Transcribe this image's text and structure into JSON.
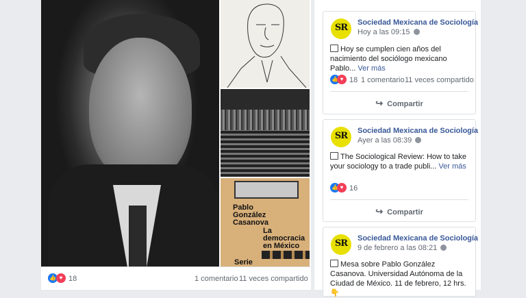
{
  "main": {
    "reactions": {
      "count": "18",
      "comments": "1 comentario",
      "shares": "11 veces compartido"
    },
    "book": {
      "author1": "Pablo",
      "author2": "González",
      "author3": "Casanova",
      "title1": "La",
      "title2": "democracia",
      "title3": "en México",
      "series": "Serie"
    }
  },
  "feed": {
    "posts": [
      {
        "page": "Sociedad Mexicana de Sociología",
        "time": "Hoy a las 09:15",
        "text": "Hoy se cumplen cien años del nacimiento del sociólogo mexicano Pablo...",
        "more": "Ver más",
        "likes": "18",
        "comments": "1 comentario",
        "shares": "11 veces compartido",
        "share_label": "Compartir"
      },
      {
        "page": "Sociedad Mexicana de Sociología",
        "time": "Ayer a las 08:39",
        "text": "The Sociological Review: How to take your sociology to a trade publi...",
        "more": "Ver más",
        "likes": "16",
        "share_label": "Compartir"
      },
      {
        "page": "Sociedad Mexicana de Sociología",
        "time": "9 de febrero a las 08:21",
        "text": "Mesa sobre Pablo González Casanova. Universidad Autónoma de la Ciudad de México. 11 de febrero, 12 hrs. 👇"
      }
    ]
  },
  "avatar_text": "SR",
  "icons": {
    "like": "like-icon",
    "love": "love-icon",
    "globe": "globe-icon",
    "share": "share-icon"
  },
  "colors": {
    "link": "#385898",
    "like": "#1877f2",
    "love": "#f33e58",
    "avatar": "#e8e000"
  }
}
